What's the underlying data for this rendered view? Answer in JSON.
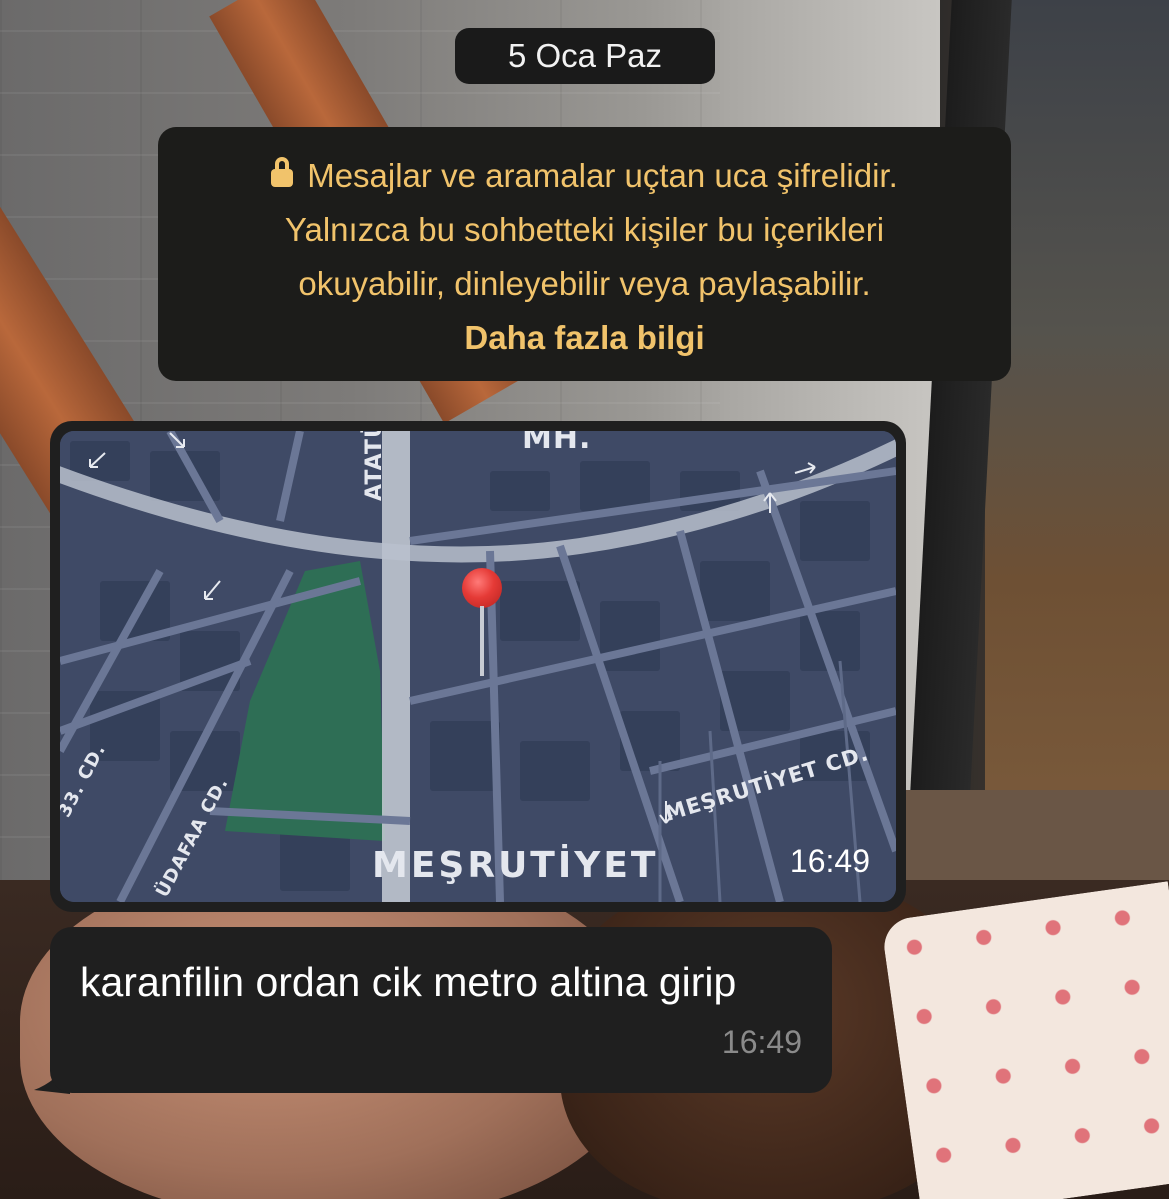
{
  "chat": {
    "date_separator": "5 Oca Paz",
    "encryption_notice": {
      "lines": [
        "Mesajlar ve aramalar uçtan uca şifrelidir.",
        "Yalnızca bu sohbetteki kişiler bu içerikleri",
        "okuyabilir, dinleyebilir veya paylaşabilir."
      ],
      "link_label": "Daha fazla bilgi",
      "color": "#f1c36b",
      "icon": "lock-icon"
    },
    "location_message": {
      "map_labels": {
        "district_top": "MH.",
        "ataturk": "ATATÜ",
        "mesrutiyet_big": "MEŞRUTİYET",
        "mesrutiyet_cd": "MEŞRUTİYET CD.",
        "mudafaa_cd": "ÜDAFAA CD.",
        "cd3": "33. CD."
      },
      "time": "16:49",
      "pin_icon": "map-pin-icon"
    },
    "text_message": {
      "text": "karanfilin ordan cik metro altina girip",
      "time": "16:49"
    }
  },
  "colors": {
    "bubble_bg": "#1f1f1f",
    "map_bg": "#3f4a66",
    "park": "#2e6e55"
  }
}
